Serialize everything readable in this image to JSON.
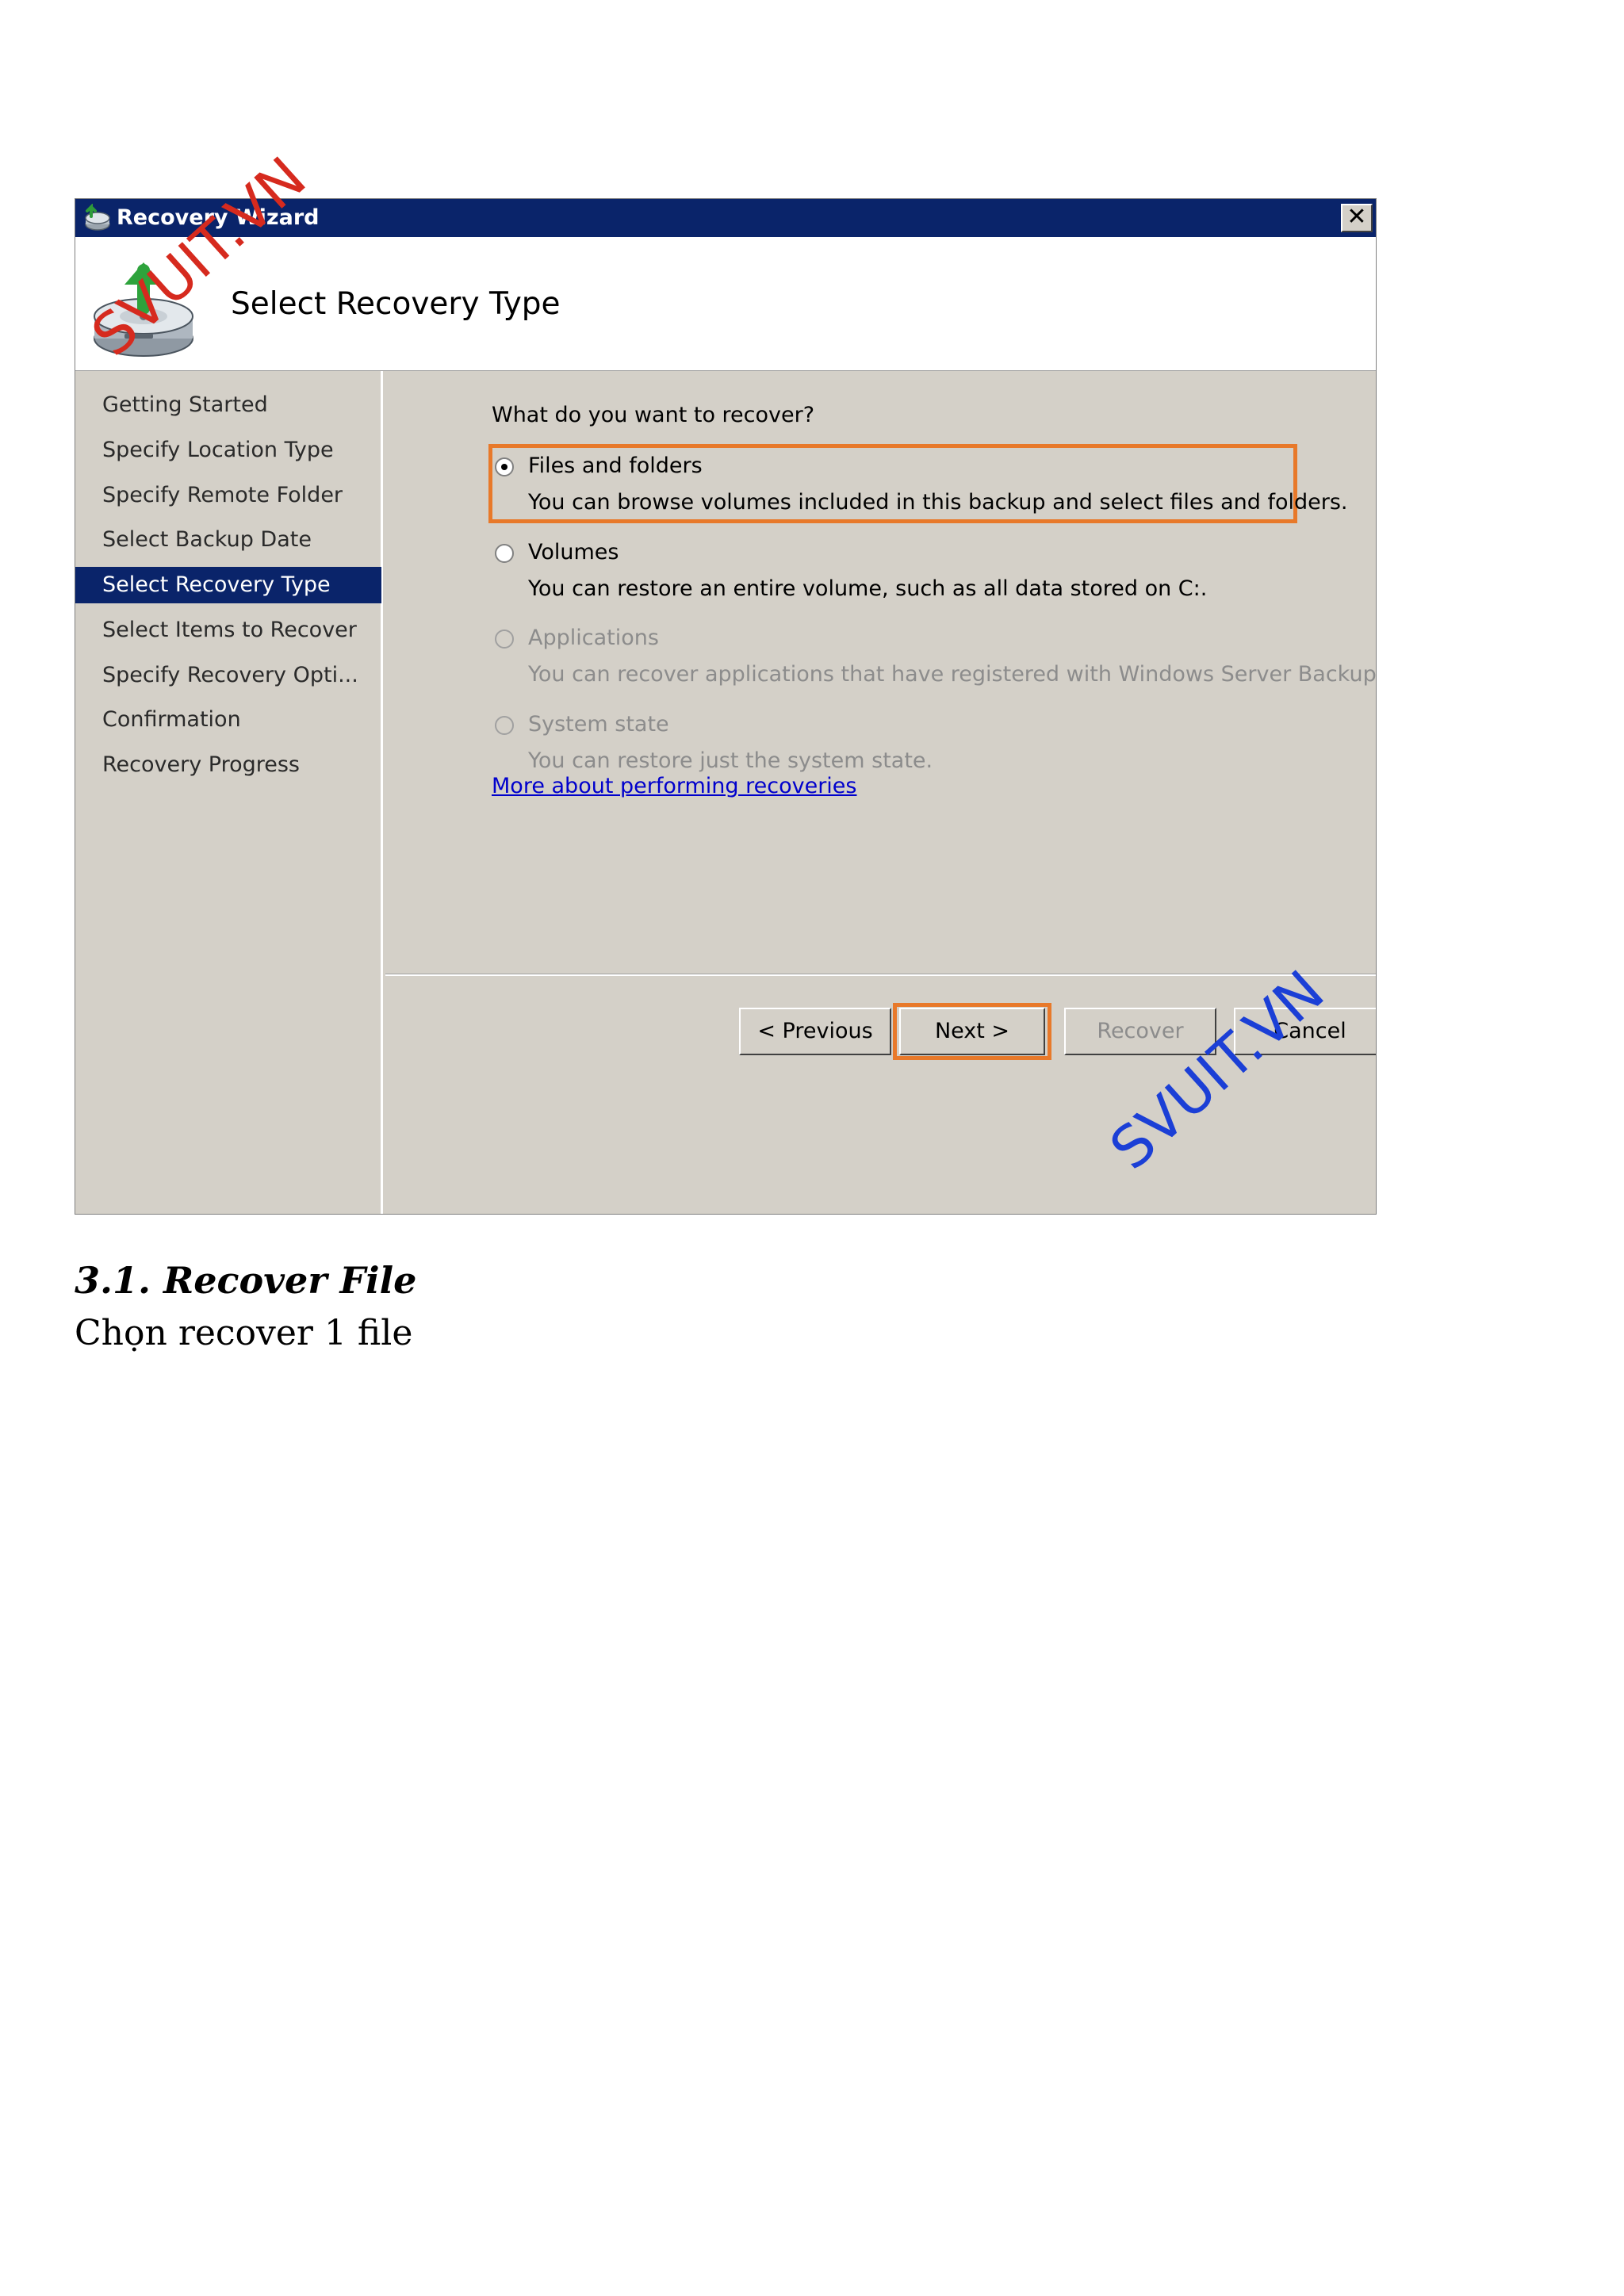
{
  "window": {
    "title": "Recovery Wizard",
    "close_label": "✕"
  },
  "header": {
    "title": "Select Recovery Type"
  },
  "nav": {
    "items": [
      {
        "label": "Getting Started"
      },
      {
        "label": "Specify Location Type"
      },
      {
        "label": "Specify Remote Folder"
      },
      {
        "label": "Select Backup Date"
      },
      {
        "label": "Select Recovery Type",
        "active": true
      },
      {
        "label": "Select Items to Recover"
      },
      {
        "label": "Specify Recovery Opti..."
      },
      {
        "label": "Confirmation"
      },
      {
        "label": "Recovery Progress"
      }
    ]
  },
  "content": {
    "question": "What do you want to recover?",
    "options": [
      {
        "label": "Files and folders",
        "description": "You can browse volumes included in this backup and select files and folders.",
        "selected": true,
        "enabled": true
      },
      {
        "label": "Volumes",
        "description": "You can restore an entire volume, such as all data stored on C:.",
        "selected": false,
        "enabled": true
      },
      {
        "label": "Applications",
        "description": "You can recover applications that have registered with Windows Server Backup.",
        "selected": false,
        "enabled": false
      },
      {
        "label": "System state",
        "description": "You can restore just the system state.",
        "selected": false,
        "enabled": false
      }
    ],
    "more_link": "More about performing recoveries"
  },
  "buttons": {
    "previous": "< Previous",
    "next": "Next >",
    "recover": "Recover",
    "cancel": "Cancel"
  },
  "watermark": "SVUIT.VN",
  "colors": {
    "titlebar": "#0a246a",
    "highlight": "#e8792a",
    "dialog_bg": "#d4d0c8",
    "link": "#0000cc"
  },
  "document": {
    "heading": "3.1. Recover File",
    "body": "Chọn recover 1 file"
  }
}
